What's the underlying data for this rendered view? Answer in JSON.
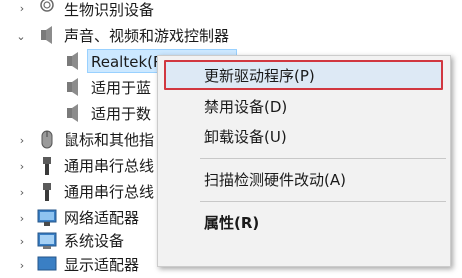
{
  "tree": {
    "items": [
      {
        "label": "生物识别设备"
      },
      {
        "label": "声音、视频和游戏控制器"
      },
      {
        "label": "Realtek(R) Audio"
      },
      {
        "label": "适用于蓝"
      },
      {
        "label": "适用于数"
      },
      {
        "label": "鼠标和其他指"
      },
      {
        "label": "通用串行总线"
      },
      {
        "label": "通用串行总线"
      },
      {
        "label": "网络适配器"
      },
      {
        "label": "系统设备"
      },
      {
        "label": "显示适配器"
      }
    ],
    "collapsed_arrow": "›",
    "expanded_arrow": "⌄"
  },
  "context_menu": {
    "items": [
      {
        "label": "更新驱动程序(P)",
        "highlighted": true
      },
      {
        "label": "禁用设备(D)"
      },
      {
        "label": "卸载设备(U)"
      },
      {
        "label": "扫描检测硬件改动(A)"
      },
      {
        "label": "属性(R)",
        "bold": true
      }
    ],
    "highlight_border_color": "#d1373f"
  },
  "colors": {
    "selection_bg": "#cce8ff",
    "menu_bg": "#f2f2f2"
  }
}
